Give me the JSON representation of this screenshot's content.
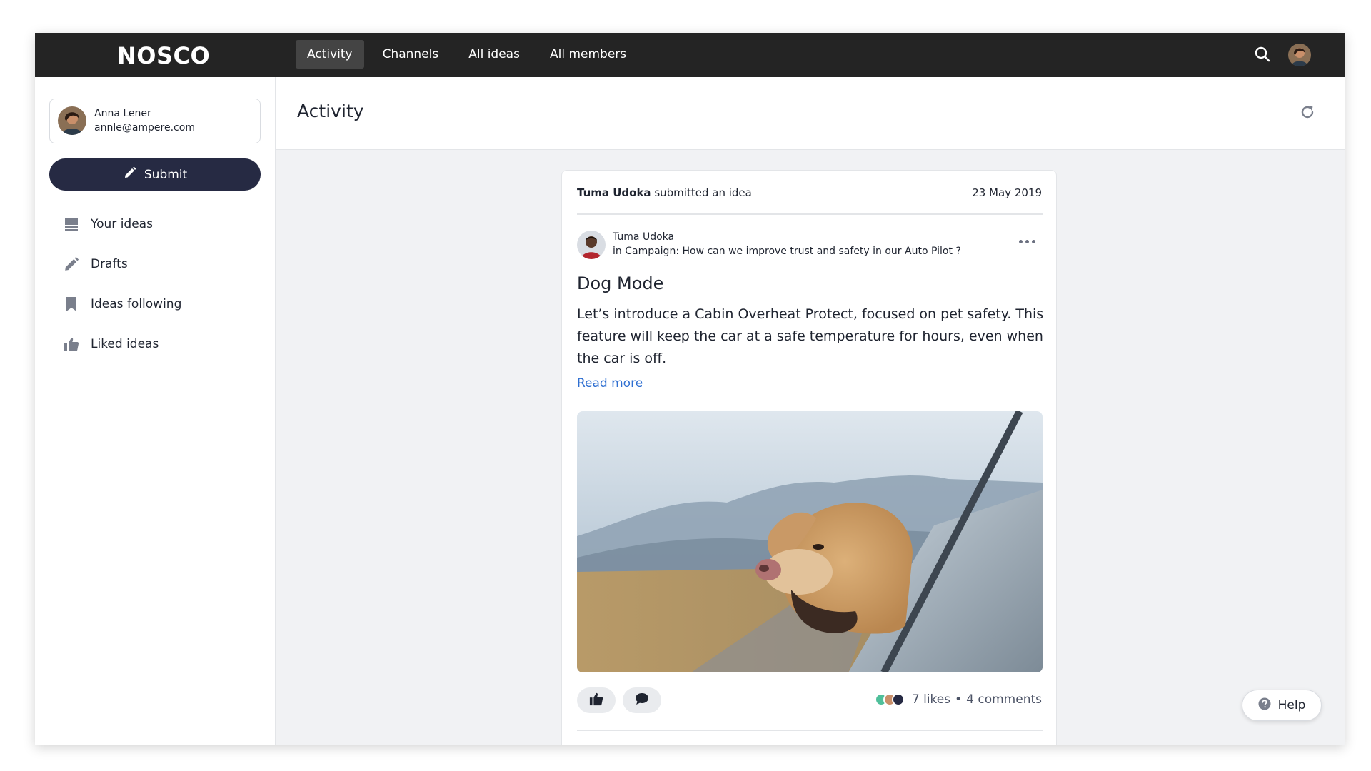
{
  "app": {
    "logo": "NOSCO"
  },
  "nav": {
    "items": [
      {
        "label": "Activity",
        "active": true
      },
      {
        "label": "Channels",
        "active": false
      },
      {
        "label": "All ideas",
        "active": false
      },
      {
        "label": "All members",
        "active": false
      }
    ],
    "icons": {
      "search": "search-icon",
      "avatar": "user-avatar"
    }
  },
  "sidebar": {
    "user": {
      "name": "Anna Lener",
      "email": "annle@ampere.com"
    },
    "submit_label": "Submit",
    "items": [
      {
        "label": "Your ideas",
        "icon": "list-icon"
      },
      {
        "label": "Drafts",
        "icon": "pencil-icon"
      },
      {
        "label": "Ideas following",
        "icon": "bookmark-icon"
      },
      {
        "label": "Liked ideas",
        "icon": "thumbs-up-icon"
      }
    ]
  },
  "main": {
    "title": "Activity",
    "card": {
      "actor": "Tuma Udoka",
      "action": "submitted an idea",
      "date": "23 May 2019",
      "author": "Tuma Udoka",
      "campaign": "in Campaign: How can we improve trust and safety in our Auto Pilot ?",
      "idea_title": "Dog Mode",
      "idea_body": "Let’s introduce a Cabin Overheat Protect, focused on pet safety. This feature will keep the car at a safe temperature for hours, even when the car is off.",
      "read_more": "Read more",
      "likes": "7 likes",
      "separator": "•",
      "comments": "4 comments"
    }
  },
  "help": {
    "label": "Help"
  },
  "colors": {
    "topbar": "#242424",
    "submit": "#262a43",
    "link": "#2f6fd1",
    "background": "#f1f2f4"
  }
}
